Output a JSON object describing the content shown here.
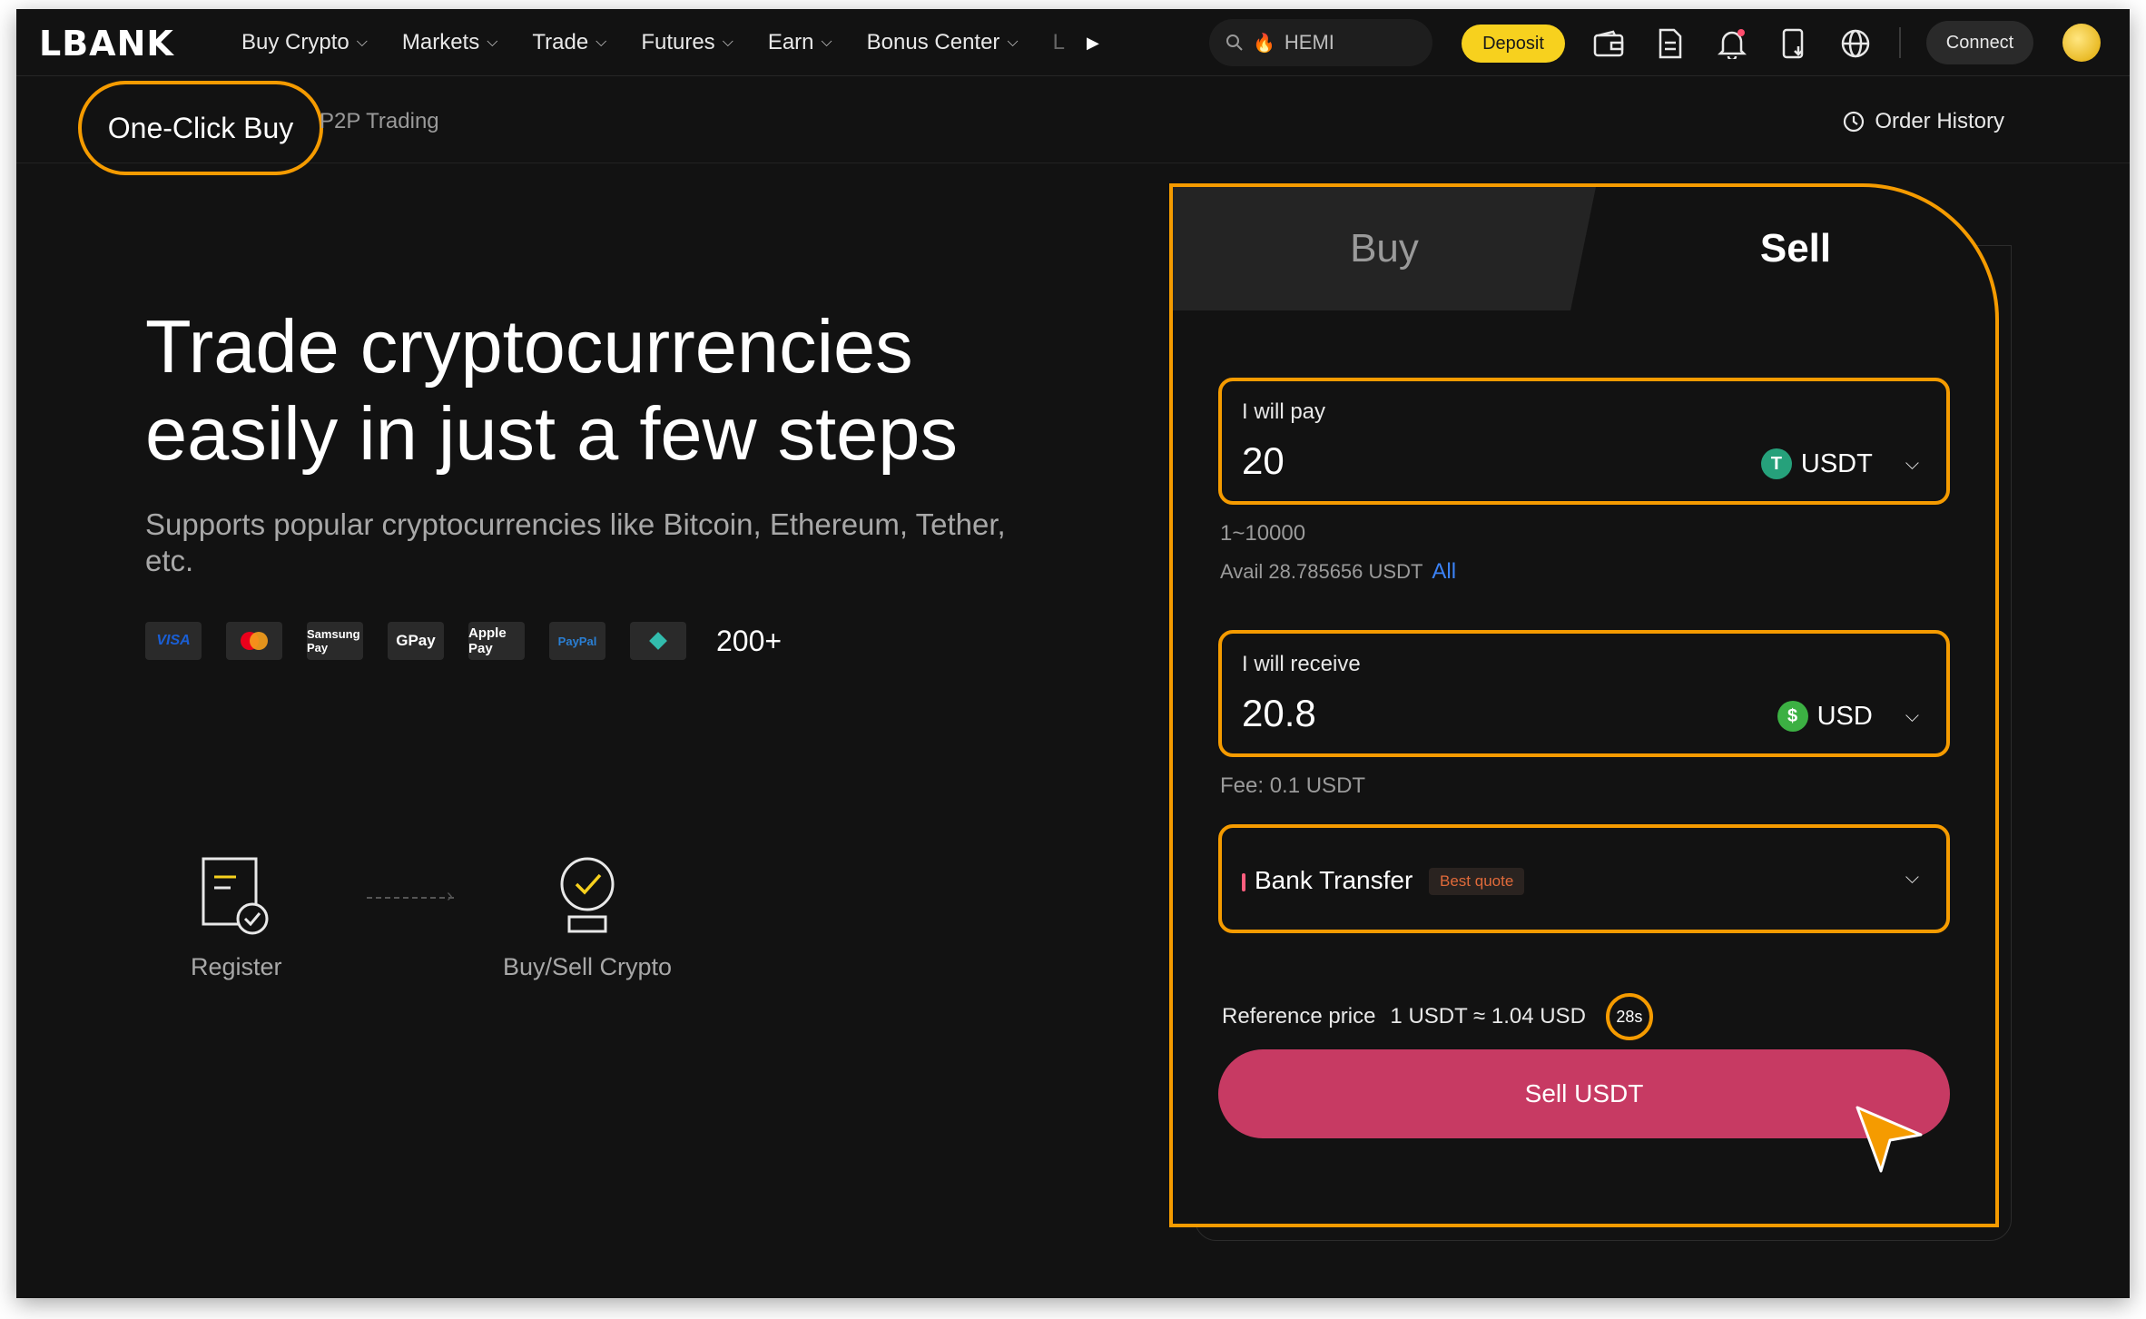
{
  "brand": {
    "logo": "LBANK"
  },
  "topnav": {
    "items": [
      {
        "label": "Buy Crypto"
      },
      {
        "label": "Markets"
      },
      {
        "label": "Trade"
      },
      {
        "label": "Futures"
      },
      {
        "label": "Earn"
      },
      {
        "label": "Bonus Center"
      }
    ],
    "more_label": "L",
    "search_placeholder": "HEMI",
    "deposit_label": "Deposit",
    "connect_label": "Connect"
  },
  "subnav": {
    "active_tab": "One-Click Buy",
    "other_tab": "P2P Trading",
    "order_history": "Order History"
  },
  "hero": {
    "title_line1": "Trade cryptocurrencies",
    "title_line2": "easily in just a few steps",
    "subtitle": "Supports popular cryptocurrencies like Bitcoin, Ethereum, Tether, etc.",
    "payment_methods": [
      "VISA",
      "Mastercard",
      "Samsung Pay",
      "GPay",
      "Apple Pay",
      "PayPal",
      "Pix"
    ],
    "payment_count": "200+"
  },
  "steps": {
    "register": "Register",
    "buy_sell": "Buy/Sell Crypto"
  },
  "trade": {
    "tab_buy": "Buy",
    "tab_sell": "Sell",
    "active_tab": "Sell",
    "pay": {
      "label": "I will pay",
      "amount": "20",
      "currency": "USDT",
      "range": "1~10000",
      "available": "Avail 28.785656 USDT",
      "all_label": "All"
    },
    "receive": {
      "label": "I will receive",
      "amount": "20.8",
      "currency": "USD",
      "fee": "Fee: 0.1 USDT"
    },
    "method": {
      "label": "Bank Transfer",
      "badge": "Best quote"
    },
    "reference_label": "Reference price",
    "reference_value": "1 USDT ≈ 1.04 USD",
    "timer": "28s",
    "submit_label": "Sell USDT"
  },
  "colors": {
    "highlight": "#f59b00",
    "sell_button": "#c73a63",
    "deposit": "#f7d11e",
    "link": "#3b82f6"
  }
}
